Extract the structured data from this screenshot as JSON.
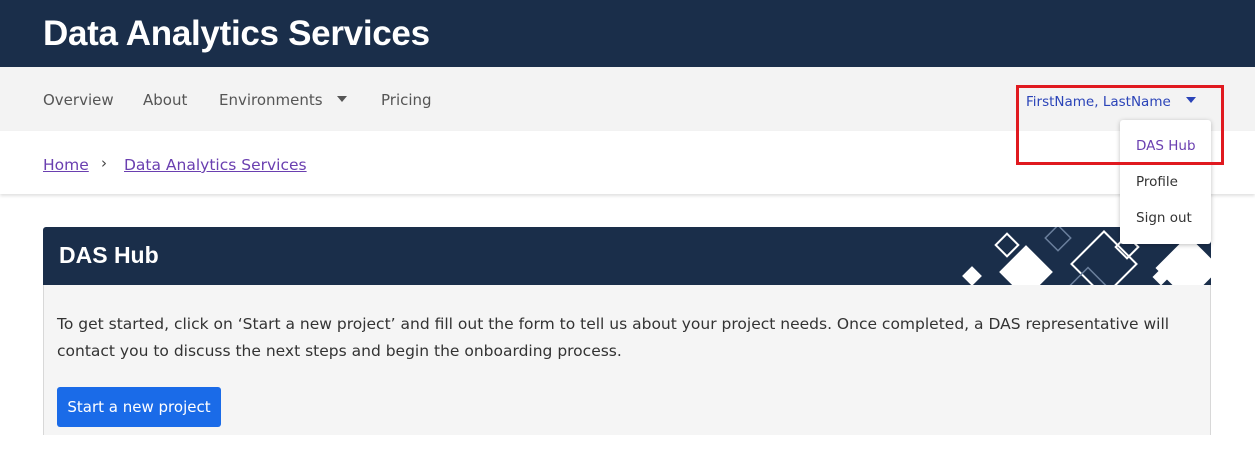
{
  "header": {
    "title": "Data Analytics Services"
  },
  "nav": {
    "items": [
      {
        "label": "Overview"
      },
      {
        "label": "About"
      },
      {
        "label": "Environments",
        "has_dropdown": true
      },
      {
        "label": "Pricing"
      }
    ],
    "user": {
      "label": "FirstName, LastName"
    }
  },
  "user_menu": {
    "items": [
      {
        "label": "DAS Hub",
        "active": true
      },
      {
        "label": "Profile"
      },
      {
        "label": "Sign out"
      }
    ]
  },
  "breadcrumb": [
    {
      "label": "Home"
    },
    {
      "label": "Data Analytics Services"
    }
  ],
  "breadcrumb_separator": "›",
  "card": {
    "title": "DAS Hub",
    "text": "To get started, click on ‘Start a new project’ and fill out the form to tell us about your project needs. Once completed, a DAS representative will contact you to discuss the next steps and begin the onboarding process.",
    "button_label": "Start a new project"
  },
  "colors": {
    "header_bg": "#1a2e4a",
    "navbar_bg": "#f3f3f3",
    "link": "#6a3fb0",
    "user_link": "#2b44b8",
    "primary_button": "#1a6be8",
    "highlight_border": "#e0191f"
  }
}
